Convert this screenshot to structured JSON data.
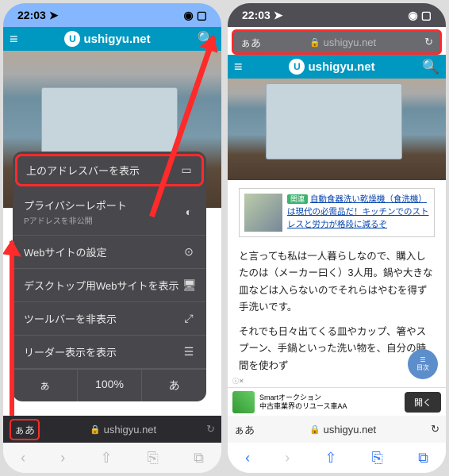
{
  "status": {
    "time": "22:03",
    "location_icon": "➤",
    "signal_icon": "▮▮▮",
    "wifi_icon": "◉",
    "battery_icon": "▢"
  },
  "site": {
    "name": "ushigyu.net",
    "hamburger": "≡",
    "search": "🔍"
  },
  "menu": {
    "items": [
      {
        "label": "上のアドレスバーを表示",
        "icon": "▭"
      },
      {
        "label": "プライバシーレポート",
        "sub": "Pアドレスを非公開",
        "icon": "◐"
      },
      {
        "label": "Webサイトの設定",
        "icon": "⊙"
      },
      {
        "label": "デスクトップ用Webサイトを表示",
        "icon": "🖥"
      },
      {
        "label": "ツールバーを非表示",
        "icon": "⤢"
      },
      {
        "label": "リーダー表示を表示",
        "icon": "☰"
      }
    ],
    "footer": {
      "small_a": "ぁ",
      "zoom": "100%",
      "big_a": "あ"
    }
  },
  "address": {
    "aa": "ぁあ",
    "lock": "🔒",
    "domain": "ushigyu.net",
    "refresh": "↻"
  },
  "nav": {
    "back": "‹",
    "forward": "›",
    "share": "⇧",
    "bookmarks": "⎘",
    "tabs": "⧉"
  },
  "article": {
    "related_tag": "関連",
    "related_link": "自動食器洗い乾燥機（食洗機）は現代の必需品だ！キッチンでのストレスと労力が格段に減るぞ",
    "p1": "と言っても私は一人暮らしなので、購入したのは（メーカー曰く）3人用。鍋や大きな皿などは入らないのでそれらはやむを得ず手洗いです。",
    "p2": "それでも日々出てくる皿やカップ、箸やスプーン、手鍋といった洗い物を、自分の時間を使わず"
  },
  "ad": {
    "label": "Smartオークション",
    "text": "中古車業界のリユース車AA",
    "button": "開く",
    "indicator": "ⓘ✕"
  },
  "fab": {
    "icon": "☰",
    "label": "目次"
  }
}
